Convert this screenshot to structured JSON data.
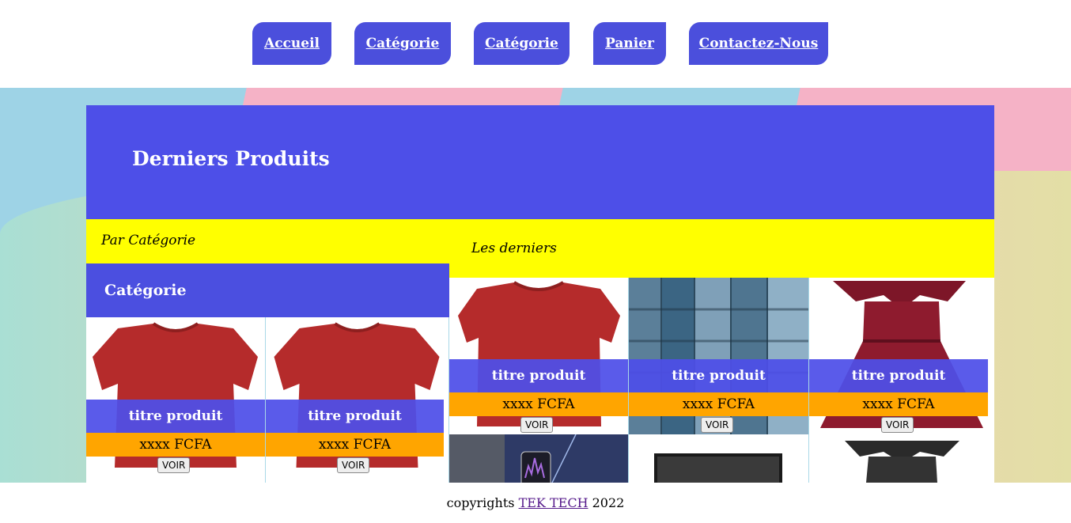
{
  "nav": {
    "items": [
      {
        "label": "Accueil"
      },
      {
        "label": "Catégorie"
      },
      {
        "label": "Catégorie"
      },
      {
        "label": "Panier"
      },
      {
        "label": "Contactez-Nous"
      }
    ]
  },
  "hero": {
    "title": "Derniers Produits"
  },
  "sidebar": {
    "par_categorie": "Par Catégorie",
    "heading": "Catégorie",
    "products": [
      {
        "title": "titre produit",
        "price": "xxxx FCFA",
        "button": "VOIR"
      },
      {
        "title": "titre produit",
        "price": "xxxx FCFA",
        "button": "VOIR"
      }
    ]
  },
  "latest": {
    "heading": "Les derniers",
    "products": [
      {
        "title": "titre produit",
        "price": "xxxx FCFA",
        "button": "VOIR"
      },
      {
        "title": "titre produit",
        "price": "xxxx FCFA",
        "button": "VOIR"
      },
      {
        "title": "titre produit",
        "price": "xxxx FCFA",
        "button": "VOIR"
      }
    ]
  },
  "footer": {
    "prefix": "copyrights",
    "link": "TEK TECH",
    "suffix": "2022"
  },
  "colors": {
    "nav": "#4b4fdc",
    "hero": "#4d4fe8",
    "highlight": "#ffff00",
    "price": "#ffa500"
  }
}
